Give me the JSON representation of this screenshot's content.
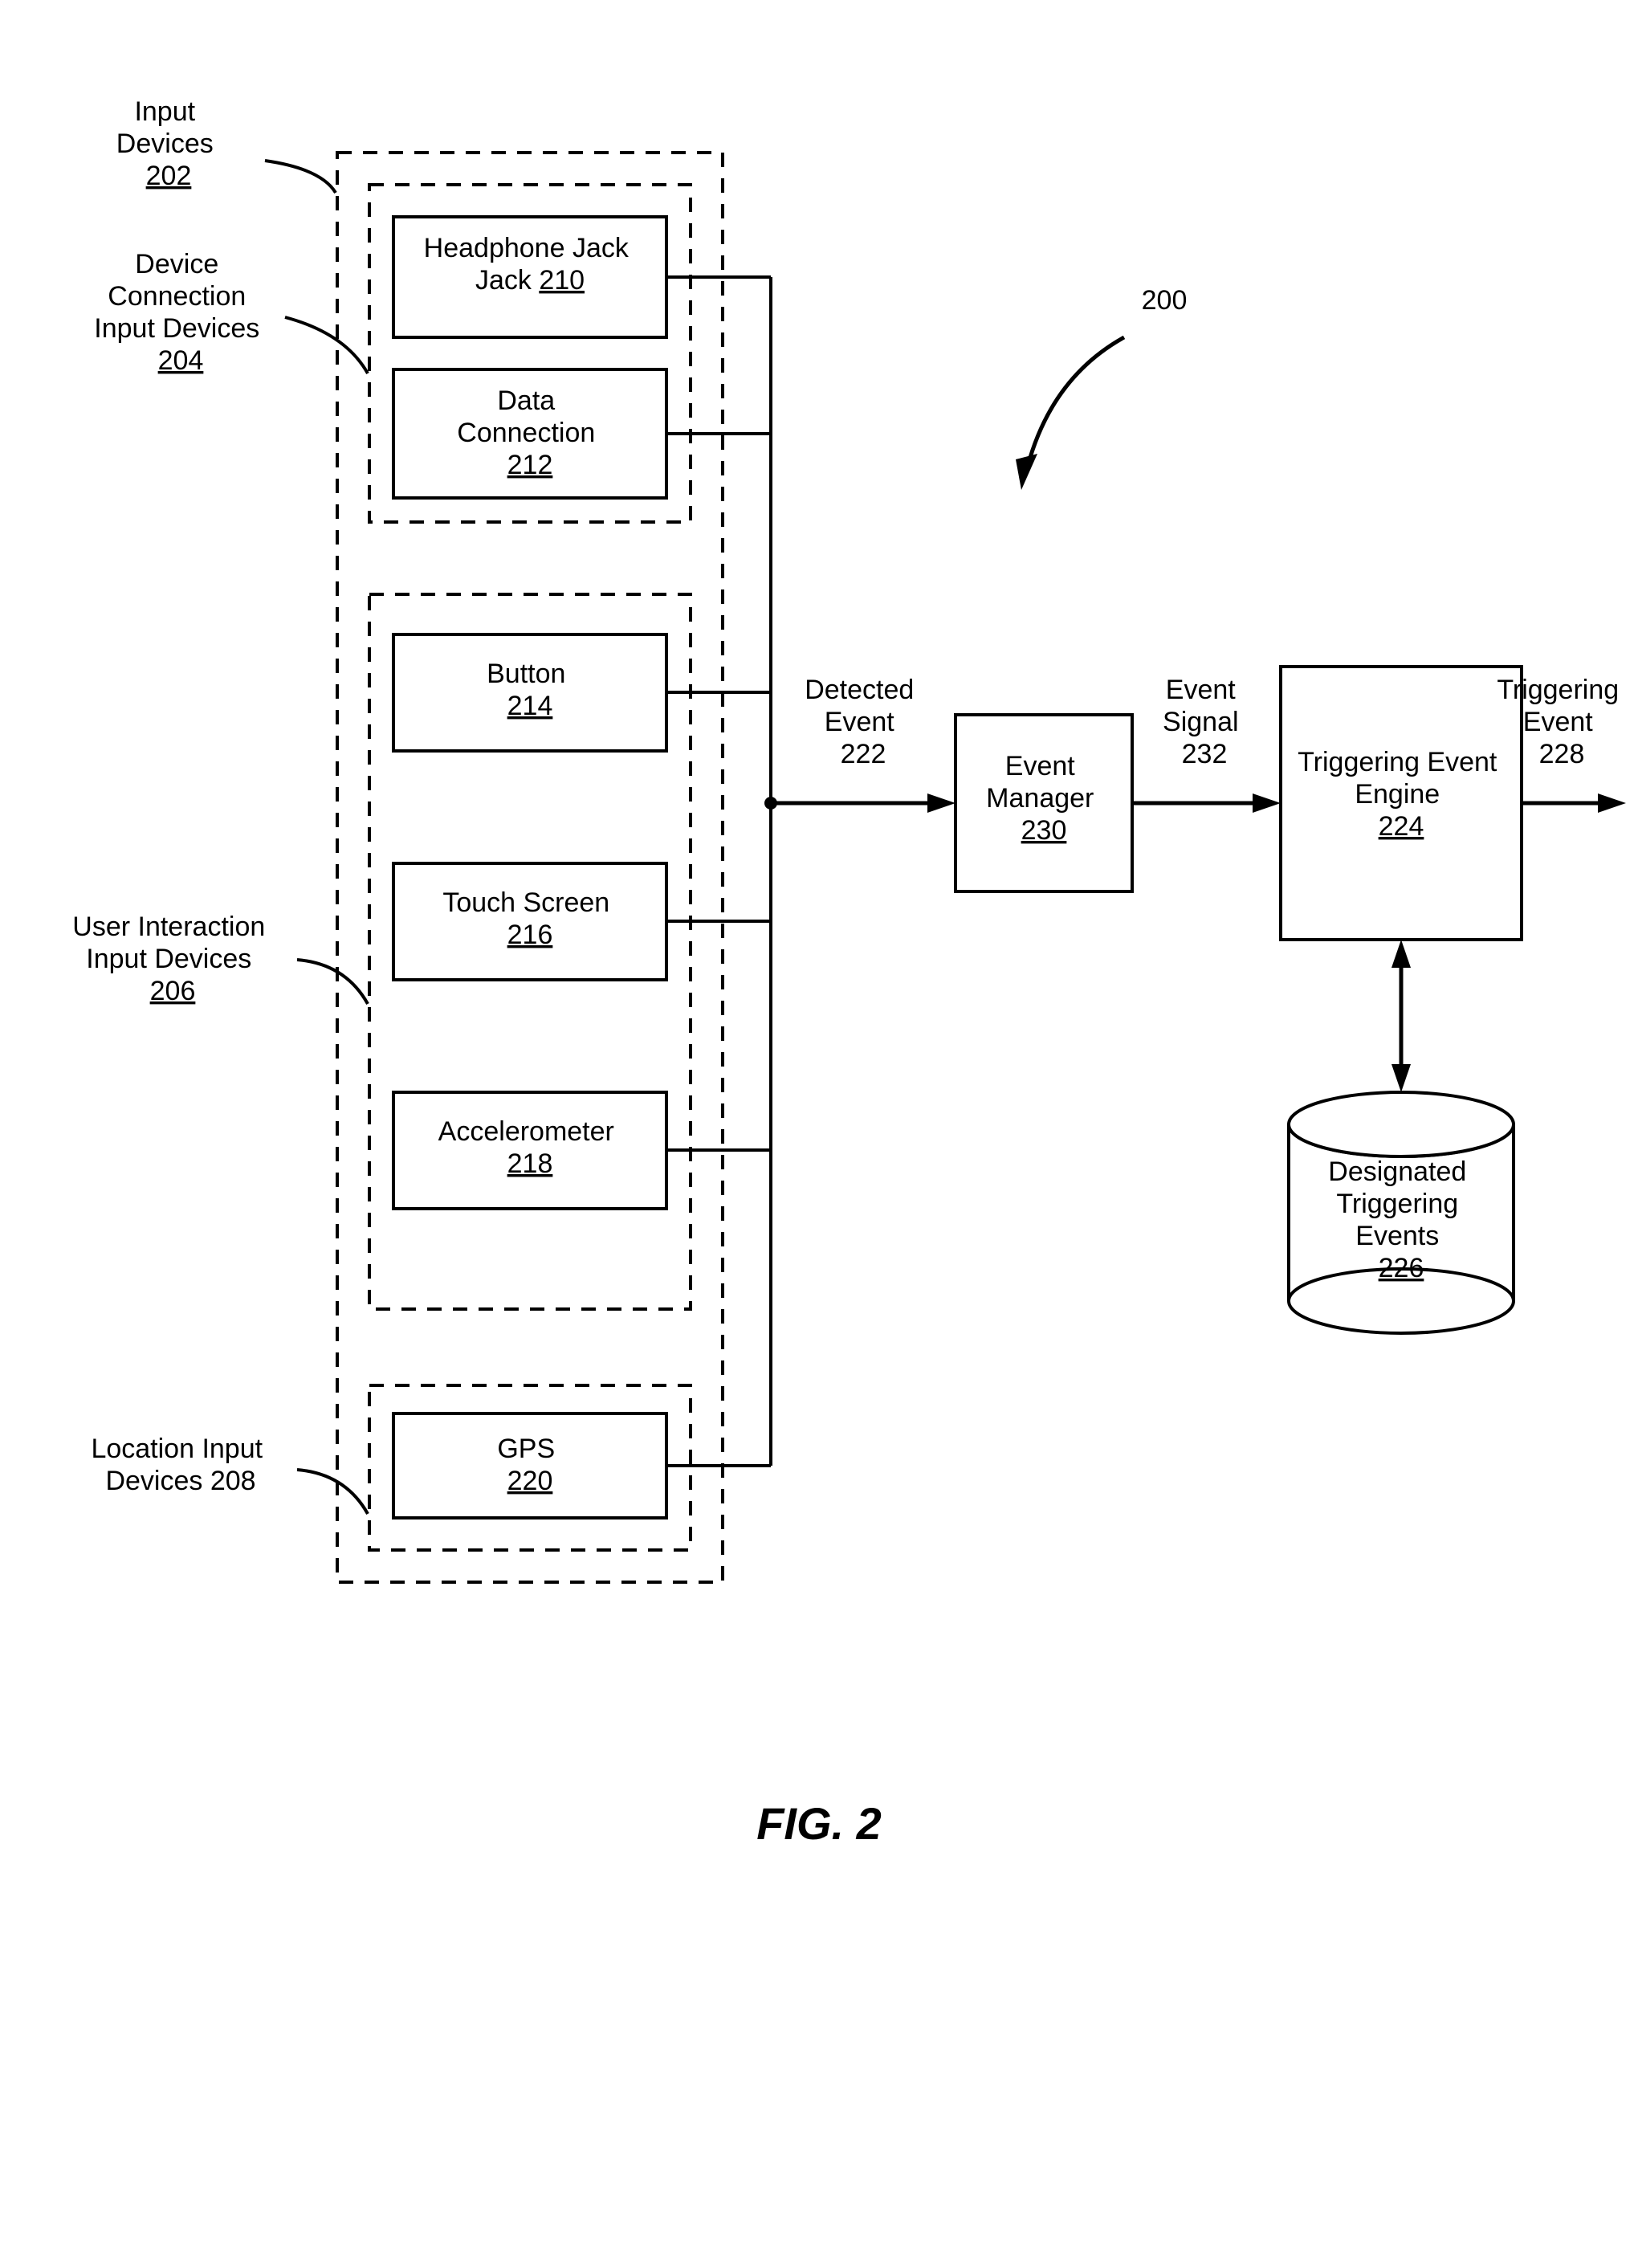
{
  "figure": {
    "number": "200",
    "caption": "FIG. 2",
    "labels": {
      "input_devices": "Input\nDevices",
      "input_devices_num": "202",
      "dev_conn": "Device\nConnection\nInput Devices",
      "dev_conn_num": "204",
      "user_int": "User Interaction\nInput Devices",
      "user_int_num": "206",
      "loc_inp": "Location Input\nDevices",
      "loc_inp_num": "208"
    },
    "boxes": {
      "headphone": "Headphone\nJack",
      "headphone_num": "210",
      "data_conn": "Data\nConnection",
      "data_conn_num": "212",
      "button": "Button",
      "button_num": "214",
      "touch": "Touch Screen",
      "touch_num": "216",
      "accel": "Accelerometer",
      "accel_num": "218",
      "gps": "GPS",
      "gps_num": "220",
      "event_mgr": "Event\nManager",
      "event_mgr_num": "230",
      "trig_eng": "Triggering Event\nEngine",
      "trig_eng_num": "224",
      "desig": "Designated\nTriggering\nEvents",
      "desig_num": "226"
    },
    "signals": {
      "detected": "Detected\nEvent",
      "detected_num": "222",
      "event_sig": "Event\nSignal",
      "event_sig_num": "232",
      "trig_evt": "Triggering\nEvent",
      "trig_evt_num": "228"
    }
  }
}
